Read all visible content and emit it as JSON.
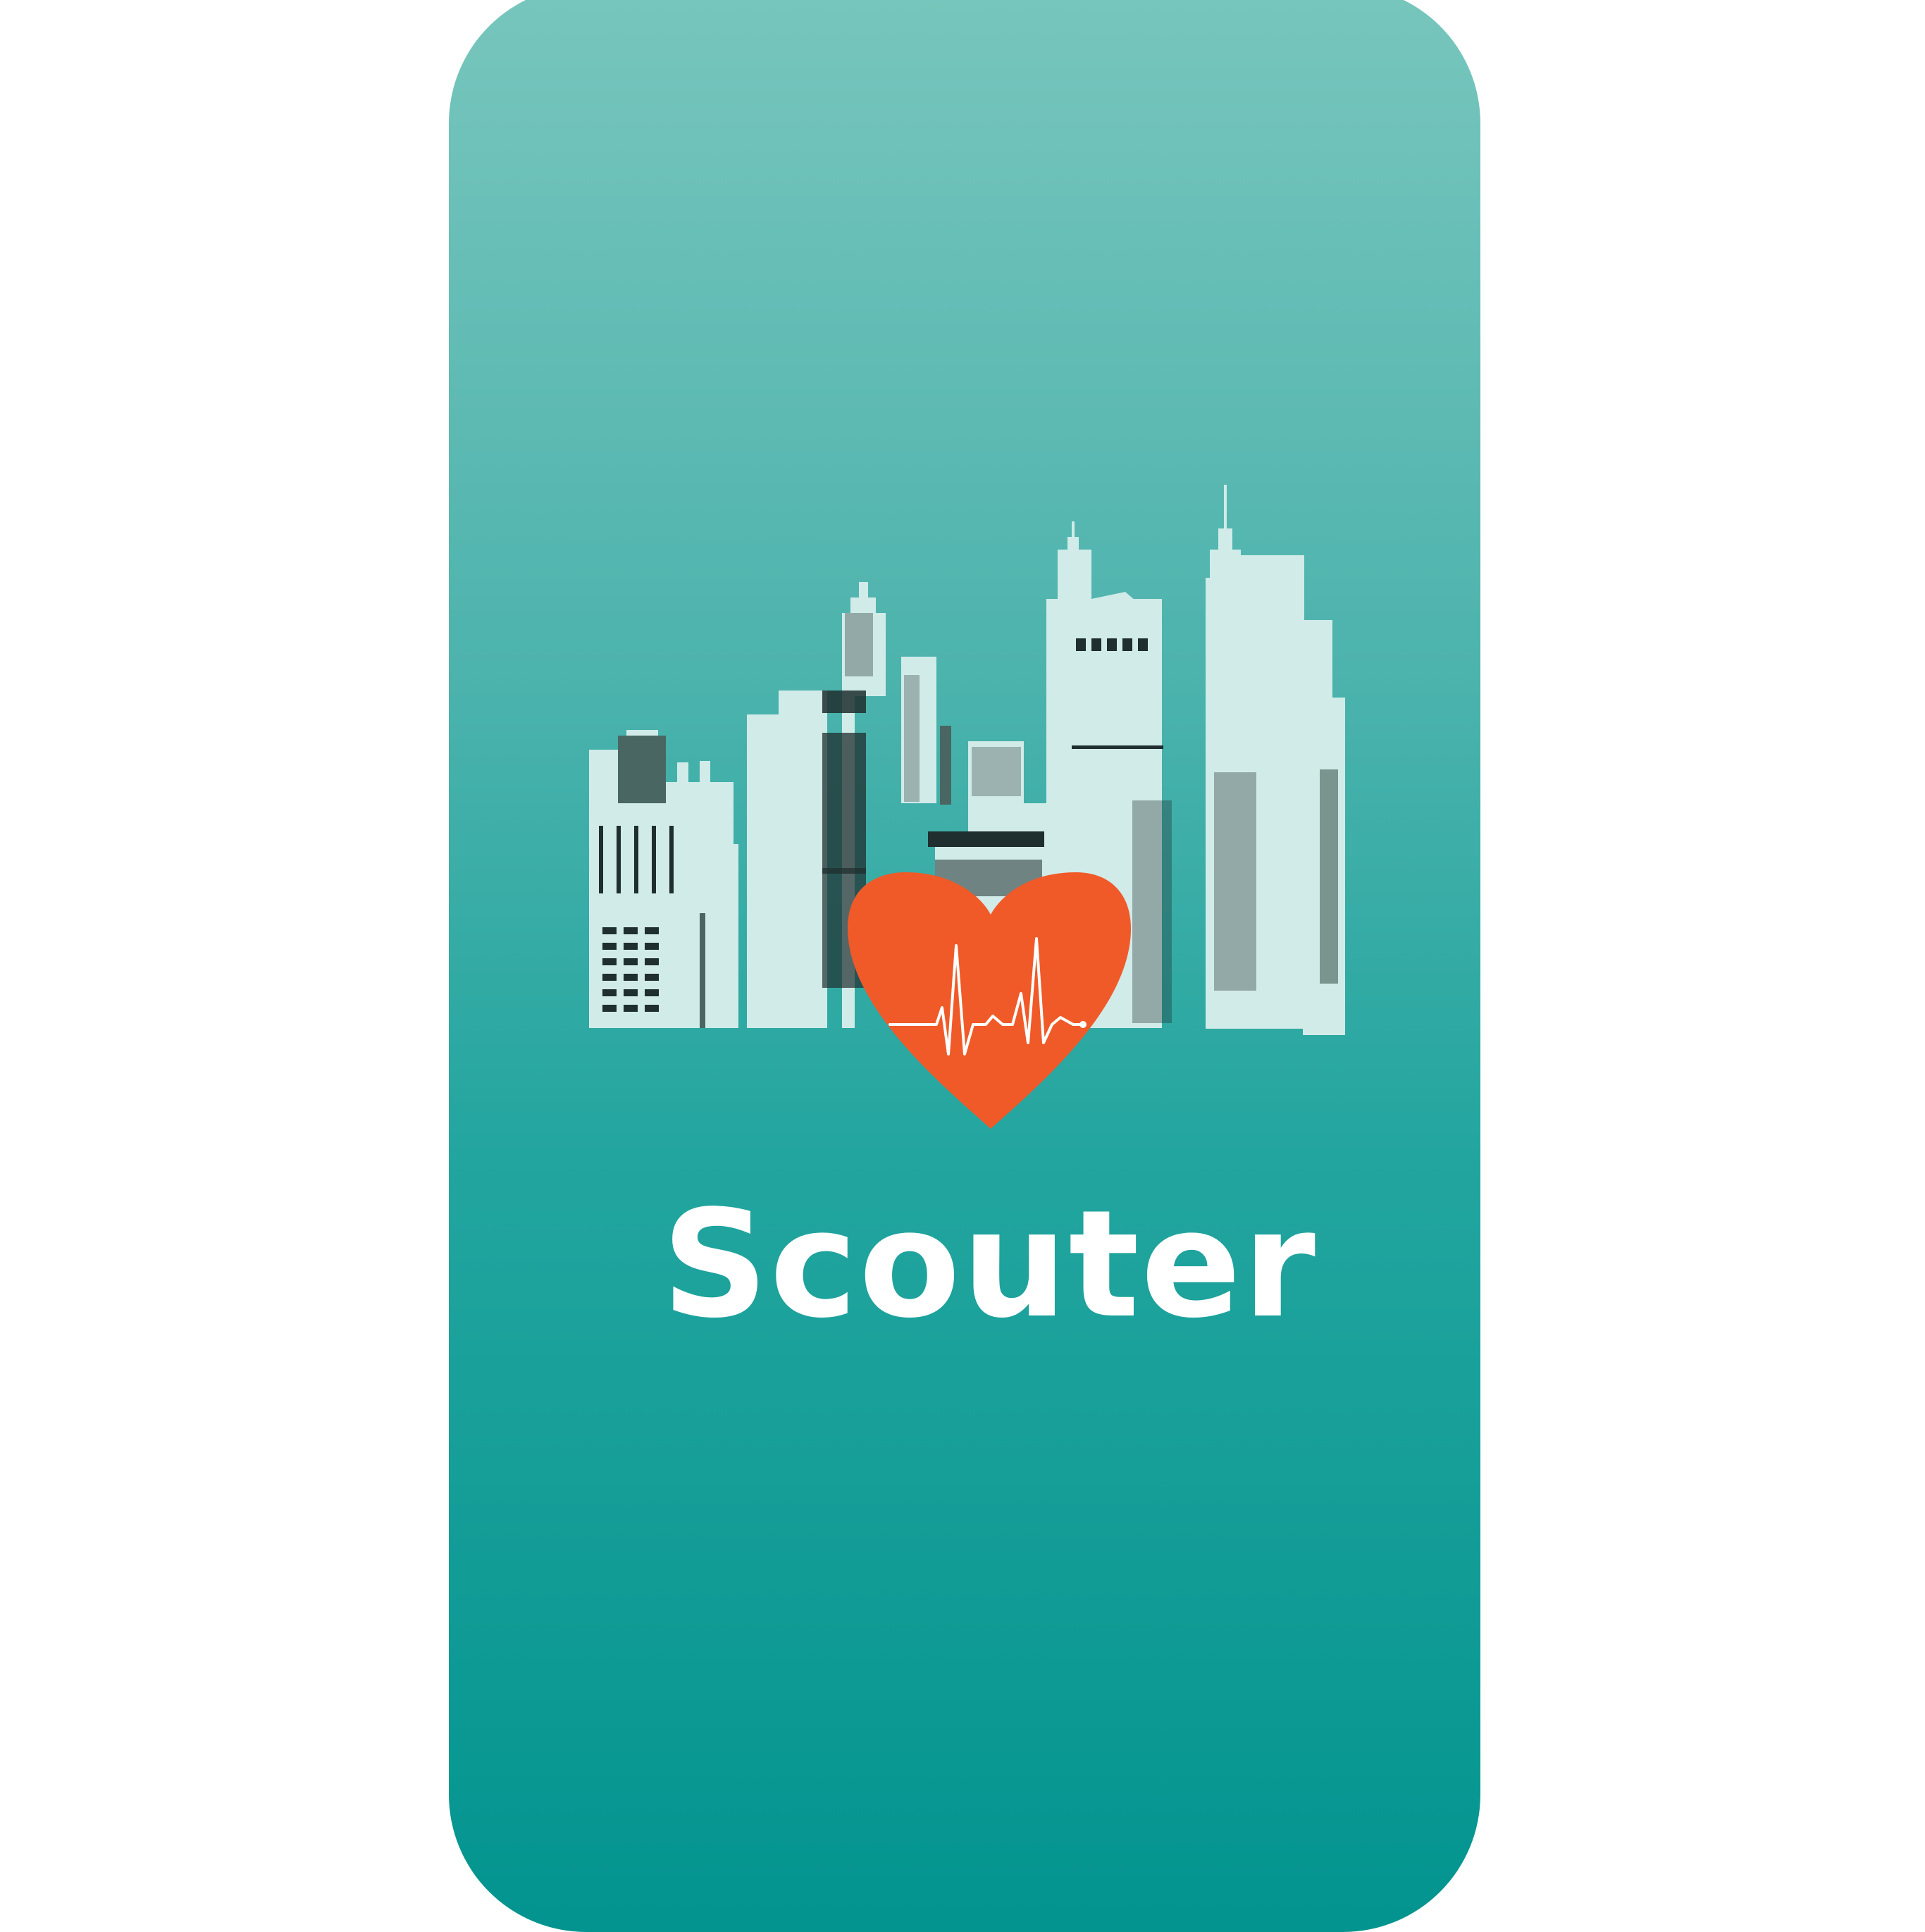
{
  "app": {
    "name": "Scouter"
  },
  "logo": {
    "icon": "city-skyline-heart-icon",
    "heart_icon": "heartbeat-icon",
    "colors": {
      "background_top": "#78c6bd",
      "background_bottom": "#03948f",
      "buildings": "#d1ebe9",
      "windows": "#1f2e2e",
      "heart": "#f05a28",
      "pulse_line": "#ffffff"
    }
  }
}
